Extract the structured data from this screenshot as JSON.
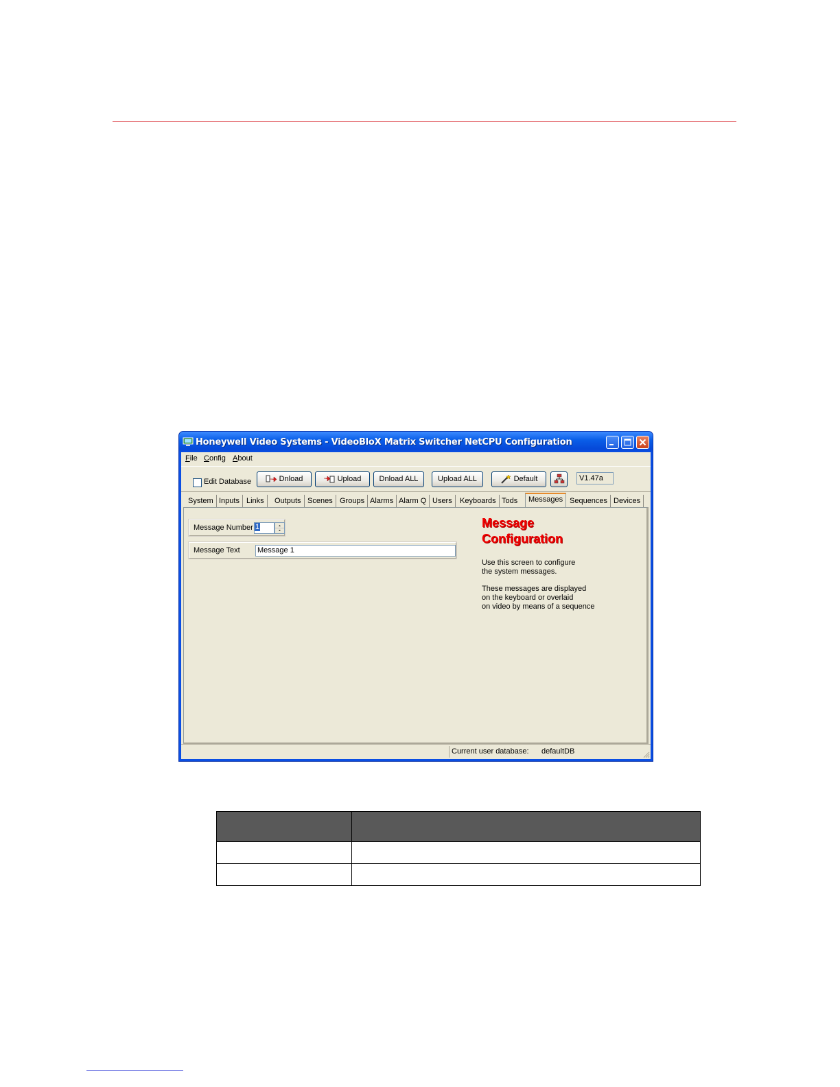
{
  "window": {
    "title": "Honeywell Video Systems - VideoBloX Matrix Switcher NetCPU Configuration"
  },
  "menu": [
    {
      "label": "File",
      "accel": "F",
      "rest": "ile"
    },
    {
      "label": "Config",
      "accel": "C",
      "rest": "onfig"
    },
    {
      "label": "About",
      "accel": "A",
      "rest": "bout"
    }
  ],
  "toolbar": {
    "edit_database_label": "Edit Database",
    "edit_database_checked": false,
    "dnload_label": "Dnload",
    "upload_label": "Upload",
    "dnload_all_label": "Dnload ALL",
    "upload_all_label": "Upload ALL",
    "default_label": "Default",
    "version": "V1.47a"
  },
  "tabs": [
    "System",
    "Inputs",
    "Links",
    "Outputs",
    "Scenes",
    "Groups",
    "Alarms",
    "Alarm Q",
    "Users",
    "Keyboards",
    "Tods",
    "Messages",
    "Sequences",
    "Devices"
  ],
  "active_tab": "Messages",
  "form": {
    "message_number_label": "Message Number",
    "message_number_value": "1",
    "message_text_label": "Message Text",
    "message_text_value": "Message  1"
  },
  "info": {
    "heading_line1": "Message",
    "heading_line2": "Configuration",
    "para1_line1": "Use this screen to configure",
    "para1_line2": "the system messages.",
    "para2_line1": "These messages are displayed",
    "para2_line2": "on the keyboard or overlaid",
    "para2_line3": "on video by means of a sequence"
  },
  "status": {
    "label": "Current user database:",
    "value": "defaultDB"
  },
  "colors": {
    "page_rule": "#d8232a",
    "title_bar": "#0a4ee3",
    "heading_red": "#f10000",
    "table_header": "#595959"
  }
}
